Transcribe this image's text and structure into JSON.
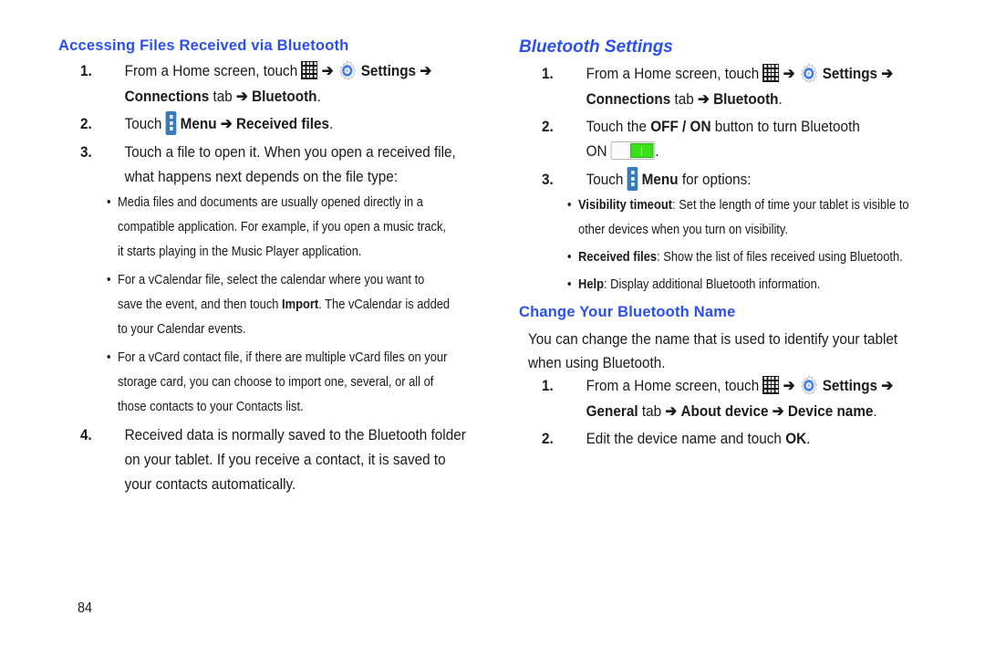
{
  "page_number": "84",
  "left": {
    "heading": "Accessing Files Received via Bluetooth",
    "steps": [
      {
        "num": "1.",
        "line1_pre": "From a Home screen, touch",
        "apps_icon": "apps-grid-icon",
        "arrow": "➔",
        "settings_icon": "settings-gear-icon",
        "settings_label": "Settings",
        "line2_bold1": "Connections",
        "line2_text": " tab ",
        "line2_bold2": "Bluetooth",
        "line2_end": "."
      },
      {
        "num": "2.",
        "pre": "Touch",
        "menu_icon": "menu-icon",
        "bold1": "Menu",
        "bold2": "Received files",
        "end": "."
      },
      {
        "num": "3.",
        "line1": "Touch a file to open it. When you open a received file,",
        "line2": "what happens next depends on the file type:",
        "bullets": [
          {
            "lines": [
              "Media files and documents are usually opened directly in a",
              "compatible application. For example, if you open a music track,",
              "it starts playing in the Music Player application."
            ]
          },
          {
            "line1": "For a vCalendar file, select the calendar where you want to",
            "line2_pre": "save the event, and then touch ",
            "line2_bold": "Import",
            "line2_post": ". The vCalendar is added",
            "line3": "to your Calendar events."
          },
          {
            "lines": [
              "For a vCard contact file, if there are multiple vCard files on your",
              "storage card, you can choose to import one, several, or all of",
              "those contacts to your Contacts list."
            ]
          }
        ]
      },
      {
        "num": "4.",
        "lines": [
          "Received data is normally saved to the Bluetooth folder",
          "on your tablet. If you receive a contact, it is saved to",
          "your contacts automatically."
        ]
      }
    ]
  },
  "right": {
    "heading": "Bluetooth Settings",
    "steps": [
      {
        "num": "1.",
        "line1_pre": "From a Home screen, touch",
        "arrow": "➔",
        "settings_label": "Settings",
        "line2_bold1": "Connections",
        "line2_text": " tab ",
        "line2_bold2": "Bluetooth",
        "line2_end": "."
      },
      {
        "num": "2.",
        "pre": "Touch the ",
        "bold": "OFF / ON",
        "post": " button to turn Bluetooth",
        "line2": "ON",
        "toggle_state": "on",
        "line2_end": "."
      },
      {
        "num": "3.",
        "pre": "Touch",
        "bold": "Menu",
        "post": " for options:",
        "bullets": [
          {
            "bold": "Visibility timeout",
            "text": ": Set the length of time your tablet is visible to",
            "line2": "other devices when you turn on visibility."
          },
          {
            "bold": "Received files",
            "text": ": Show the list of files received using Bluetooth."
          },
          {
            "bold": "Help",
            "text": ": Display additional Bluetooth information."
          }
        ]
      }
    ],
    "subheading": "Change Your Bluetooth Name",
    "intro_lines": [
      "You can change the name that is used to identify your tablet",
      "when using Bluetooth."
    ],
    "name_steps": [
      {
        "num": "1.",
        "line1_pre": "From a Home screen, touch",
        "arrow": "➔",
        "settings_label": "Settings",
        "line2_bold1": "General",
        "line2_text": " tab ",
        "line2_bold2": "About device",
        "line2_bold3": "Device name",
        "line2_end": "."
      },
      {
        "num": "2.",
        "pre": "Edit the device name and touch ",
        "bold": "OK",
        "end": "."
      }
    ]
  }
}
